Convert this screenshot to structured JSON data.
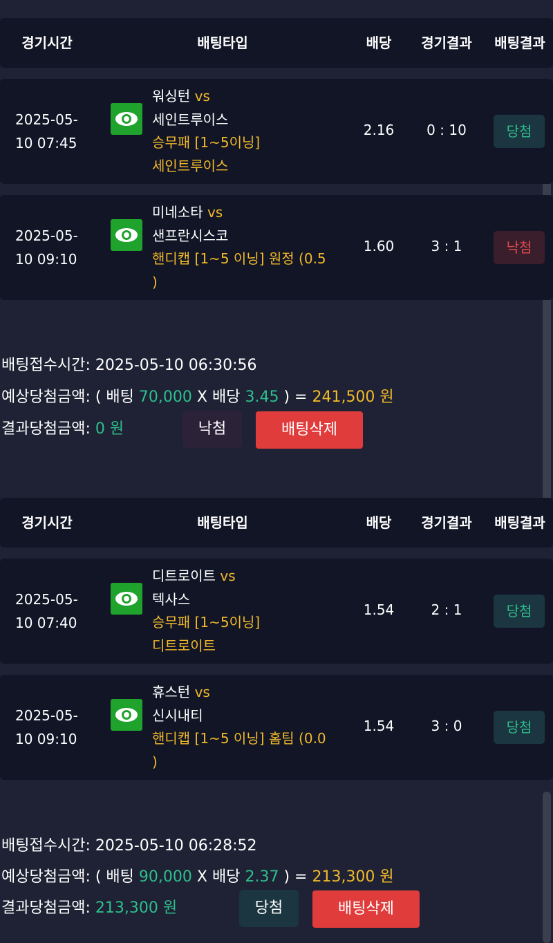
{
  "headers": {
    "time": "경기시간",
    "type": "배팅타입",
    "odds": "배당",
    "result": "경기결과",
    "bet_result": "배팅결과"
  },
  "slips": [
    {
      "rows": [
        {
          "date": "2025-05-",
          "clock": "10 07:45",
          "home": "워싱턴",
          "vs": "vs",
          "away": "세인트루이스",
          "market": "승무패 [1~5이닝]",
          "pick": "세인트루이스",
          "odds": "2.16",
          "score": "0 : 10",
          "status": "당첨"
        },
        {
          "date": "2025-05-",
          "clock": "10 09:10",
          "home": "미네소타",
          "vs": "vs",
          "away": "샌프란시스코",
          "market": "핸디캡 [1~5 이닝] 원정 (0.5",
          "pick": ")",
          "odds": "1.60",
          "score": "3 : 1",
          "status": "낙첨"
        }
      ],
      "summary": {
        "received_label": "배팅접수시간:",
        "received_value": "2025-05-10 06:30:56",
        "expected_label": "예상당첨금액:",
        "open_paren": "( 배팅",
        "stake": "70,000",
        "x_label": "X 배당",
        "total_odds": "3.45",
        "close_eq": ") =",
        "expected_amount": "241,500 원",
        "result_label": "결과당첨금액:",
        "result_amount": "0 원",
        "status_button": "낙첨",
        "delete_button": "배팅삭제"
      }
    },
    {
      "rows": [
        {
          "date": "2025-05-",
          "clock": "10 07:40",
          "home": "디트로이트",
          "vs": "vs",
          "away": "텍사스",
          "market": "승무패 [1~5이닝]",
          "pick": "디트로이트",
          "odds": "1.54",
          "score": "2 : 1",
          "status": "당첨"
        },
        {
          "date": "2025-05-",
          "clock": "10 09:10",
          "home": "휴스턴",
          "vs": "vs",
          "away": "신시내티",
          "market": "핸디캡 [1~5 이닝] 홈팀 (0.0",
          "pick": ")",
          "odds": "1.54",
          "score": "3 : 0",
          "status": "당첨"
        }
      ],
      "summary": {
        "received_label": "배팅접수시간:",
        "received_value": "2025-05-10 06:28:52",
        "expected_label": "예상당첨금액:",
        "open_paren": "( 배팅",
        "stake": "90,000",
        "x_label": "X 배당",
        "total_odds": "2.37",
        "close_eq": ") =",
        "expected_amount": "213,300 원",
        "result_label": "결과당첨금액:",
        "result_amount": "213,300 원",
        "status_button": "당첨",
        "delete_button": "배팅삭제"
      }
    }
  ],
  "colors": {
    "background": "#1e2234",
    "panel": "#111526",
    "accent_yellow": "#f2b92a",
    "accent_green": "#2ebf8c",
    "delete_red": "#e03c3c",
    "eye_green": "#1fa32c"
  }
}
